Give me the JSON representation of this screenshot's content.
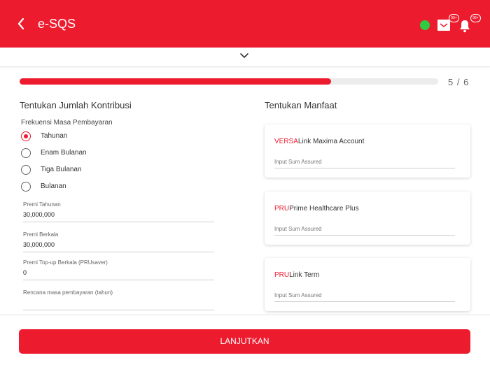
{
  "header": {
    "title": "e-SQS",
    "back_icon": "chevron-left-icon",
    "status_color": "#2ECC40",
    "mail_badge": "99+",
    "bell_badge": "99+",
    "accent": "#ED1B2E"
  },
  "progress": {
    "current": 5,
    "total": 6,
    "fraction": 0.7441,
    "text": "5 / 6"
  },
  "left": {
    "title": "Tentukan Jumlah Kontribusi",
    "frequency_label": "Frekuensi Masa Pembayaran",
    "options": [
      {
        "label": "Tahunan",
        "selected": true
      },
      {
        "label": "Enam Bulanan",
        "selected": false
      },
      {
        "label": "Tiga Bulanan",
        "selected": false
      },
      {
        "label": "Bulanan",
        "selected": false
      }
    ],
    "fields": [
      {
        "label": "Premi Tahunan",
        "value": "30,000,000"
      },
      {
        "label": "Premi Berkala",
        "value": "30,000,000"
      },
      {
        "label": "Premi Top-up Berkala (PRUsaver)",
        "value": "0"
      },
      {
        "label": "Rencana masa pembayaran (tahun)",
        "value": ""
      }
    ]
  },
  "right": {
    "title": "Tentukan Manfaat",
    "cards": [
      {
        "brand": "VERSA",
        "name": "Link Maxima Account",
        "placeholder": "Input Sum Assured"
      },
      {
        "brand": "PRU",
        "name": "Prime Healthcare Plus",
        "placeholder": "Input Sum Assured"
      },
      {
        "brand": "PRU",
        "name": "Link Term",
        "placeholder": "Input Sum Assured"
      }
    ]
  },
  "footer": {
    "button_label": "LANJUTKAN"
  }
}
